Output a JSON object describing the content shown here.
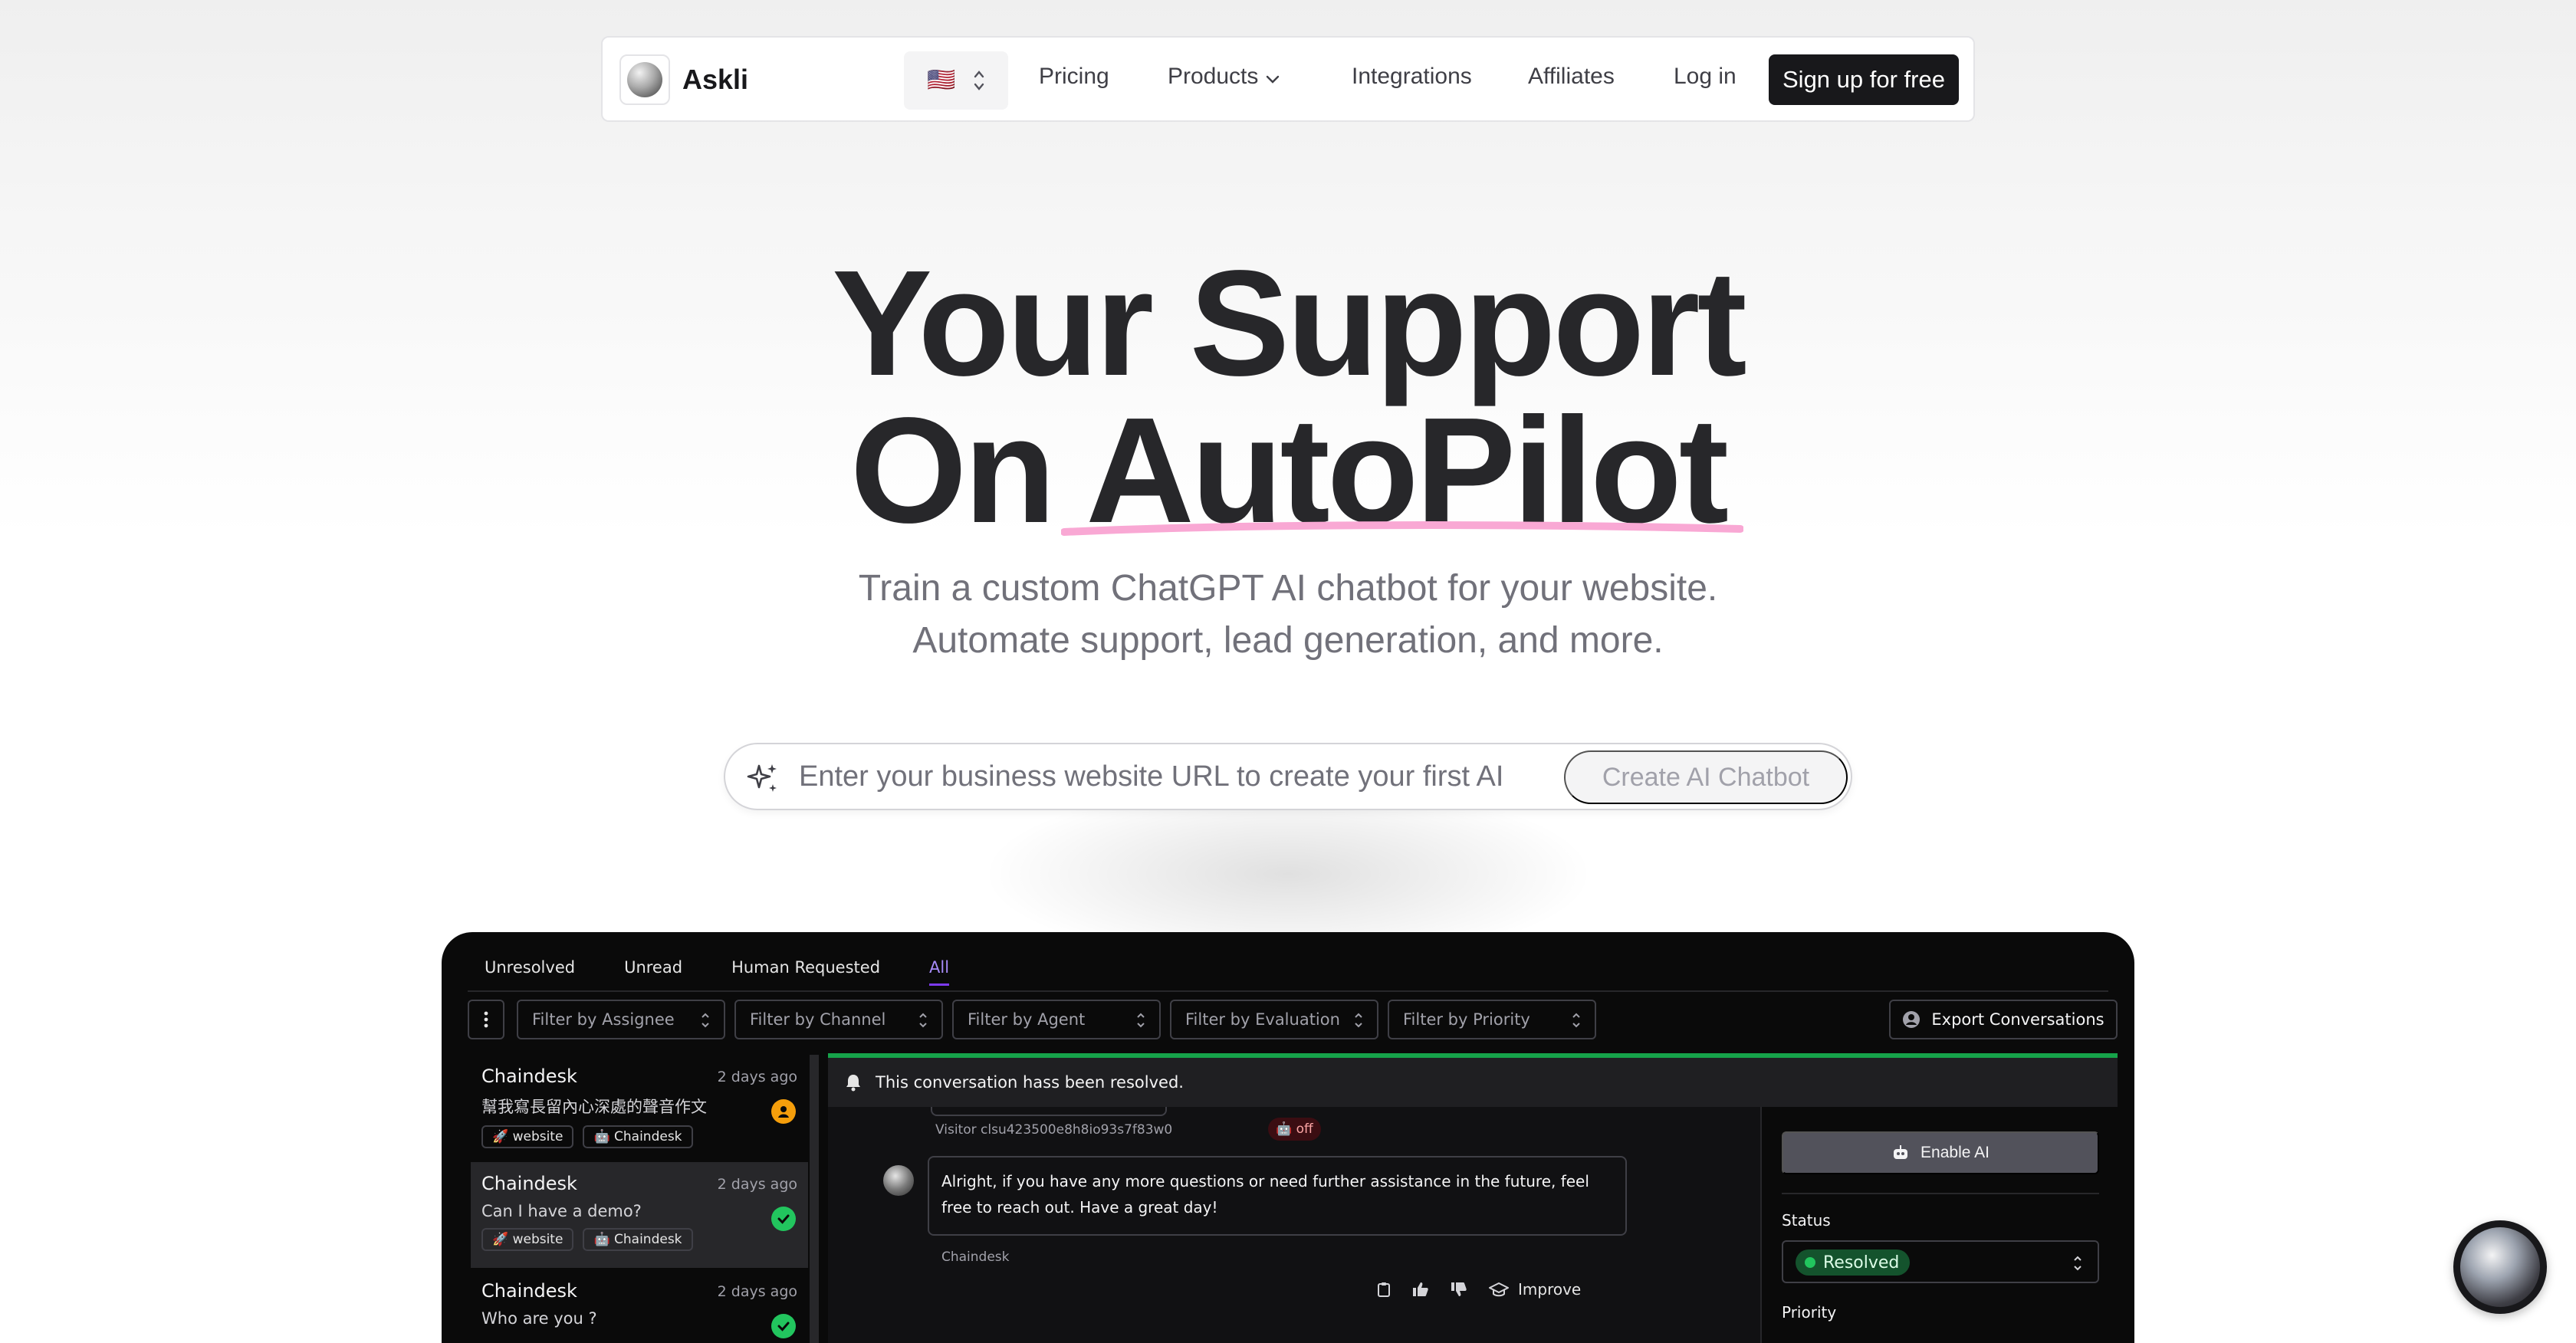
{
  "nav": {
    "brand": "Askli",
    "locale_flag": "🇺🇸",
    "links": {
      "pricing": "Pricing",
      "products": "Products",
      "integrations": "Integrations",
      "affiliates": "Affiliates",
      "login": "Log in"
    },
    "signup": "Sign up for free"
  },
  "hero": {
    "line1": "Your Support",
    "line2": "On AutoPilot",
    "subtitle_line1": "Train a custom ChatGPT AI chatbot for your website.",
    "subtitle_line2": "Automate support, lead generation, and more.",
    "underline_color": "#f9a8d4"
  },
  "search": {
    "placeholder": "Enter your business website URL to create your first AI ...",
    "button": "Create AI Chatbot"
  },
  "app": {
    "tabs": [
      "Unresolved",
      "Unread",
      "Human Requested",
      "All"
    ],
    "active_tab": "All",
    "filters": [
      "Filter by Assignee",
      "Filter by Channel",
      "Filter by Agent",
      "Filter by Evaluation",
      "Filter by Priority"
    ],
    "export_label": "Export Conversations",
    "conversations": [
      {
        "name": "Chaindesk",
        "time": "2 days ago",
        "message": "幫我寫長留內心深處的聲音作文",
        "tags": [
          "website",
          "Chaindesk"
        ],
        "status": "human"
      },
      {
        "name": "Chaindesk",
        "time": "2 days ago",
        "message": "Can I have a demo?",
        "tags": [
          "website",
          "Chaindesk"
        ],
        "status": "resolved"
      },
      {
        "name": "Chaindesk",
        "time": "2 days ago",
        "message": "Who are you ?",
        "tags": [],
        "status": "resolved"
      }
    ],
    "banner": "This conversation hass been resolved.",
    "visitor_id": "Visitor clsu423500e8h8io93s7f83w0",
    "ai_badge": "off",
    "message": "Alright, if you have any more questions or need further assistance in the future, feel free to reach out. Have a great day!",
    "message_author": "Chaindesk",
    "improve_label": "Improve",
    "enable_ai_label": "Enable AI",
    "status_label": "Status",
    "status_value": "Resolved",
    "priority_label": "Priority",
    "accent_color": "#7c3aed",
    "resolved_color": "#22c55e"
  }
}
